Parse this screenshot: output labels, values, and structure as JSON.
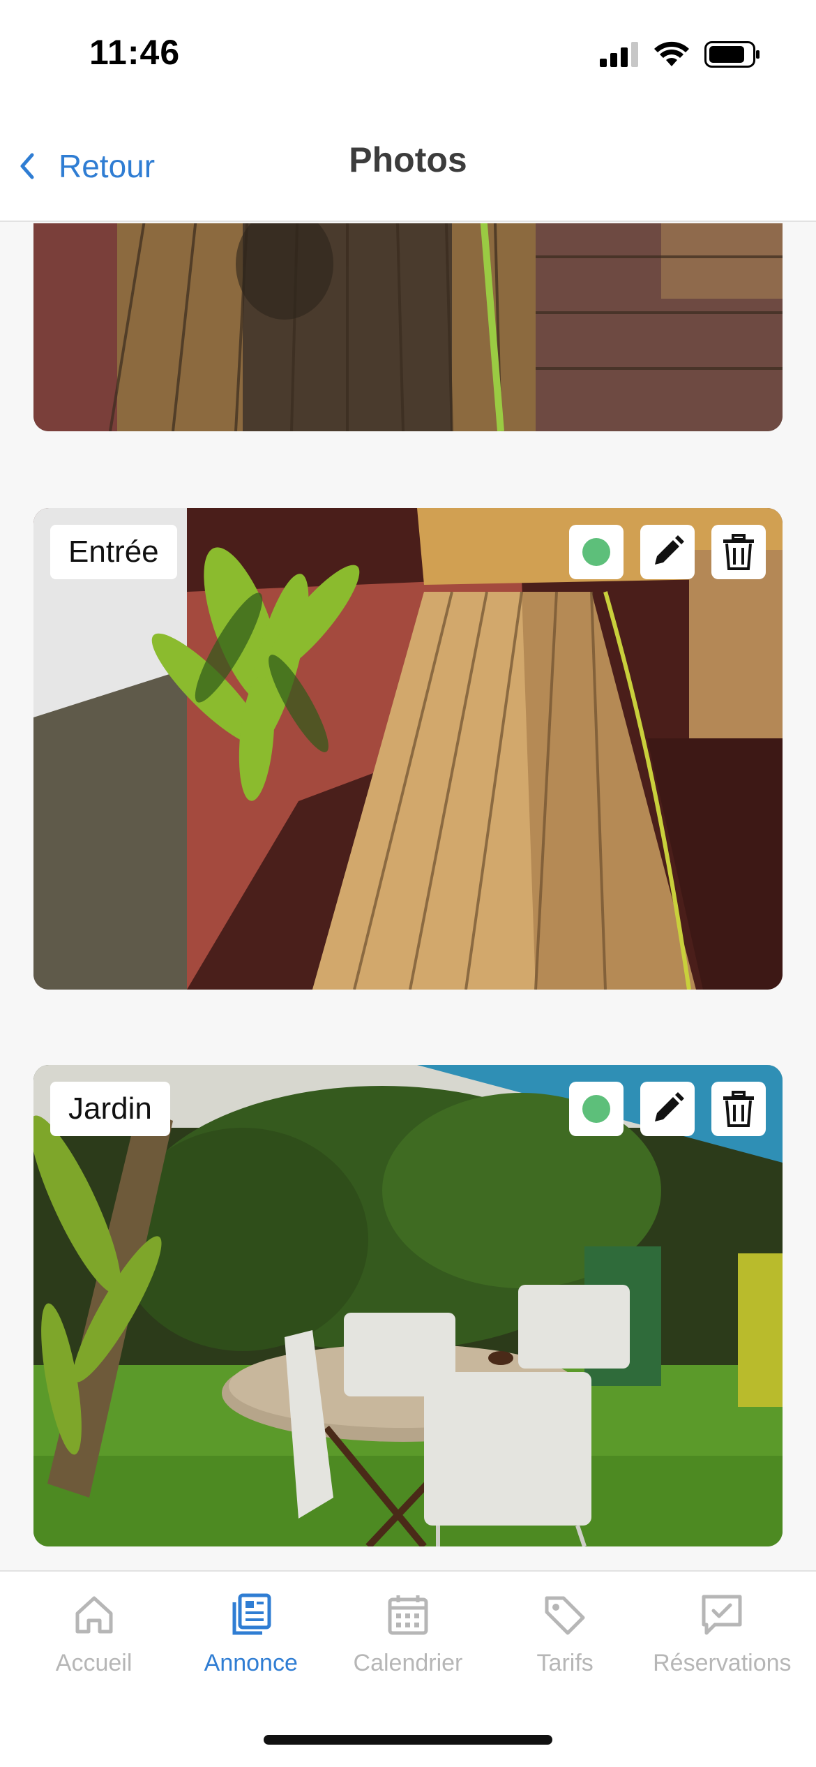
{
  "status_bar": {
    "time": "11:46",
    "icons": [
      "cellular-signal-icon",
      "wifi-icon",
      "battery-icon"
    ]
  },
  "nav": {
    "back_label": "Retour",
    "title": "Photos"
  },
  "photos": [
    {
      "label": "",
      "scene": "wooden deck boards with red gravel and a garden hose"
    },
    {
      "label": "Entrée",
      "visible": true
    },
    {
      "label": "Jardin",
      "visible": true
    }
  ],
  "tabs": [
    {
      "label": "Accueil",
      "icon": "home-icon",
      "active": false
    },
    {
      "label": "Annonce",
      "icon": "listing-icon",
      "active": true
    },
    {
      "label": "Calendrier",
      "icon": "calendar-icon",
      "active": false
    },
    {
      "label": "Tarifs",
      "icon": "price-tag-icon",
      "active": false
    },
    {
      "label": "Réservations",
      "icon": "reservations-icon",
      "active": false
    }
  ],
  "colors": {
    "accent": "#2f7dd3",
    "visible_dot": "#5dbf7a",
    "inactive_tab": "#b6b6b6"
  }
}
